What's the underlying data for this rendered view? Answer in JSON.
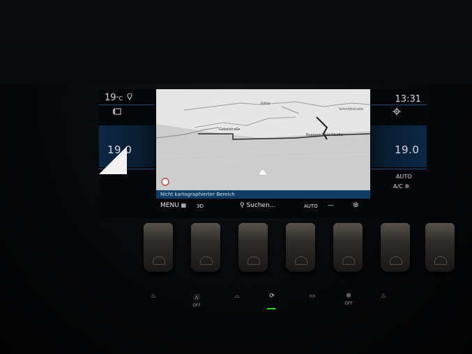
{
  "left_panel": {
    "outside_temp": "19",
    "temp_unit": "°C",
    "set_temperature": "19.0"
  },
  "right_panel": {
    "clock": "13:31",
    "set_temperature": "19.0",
    "auto_label": "AUTO",
    "ac_label": "A/C"
  },
  "map": {
    "street_labels": [
      "Ritter",
      "Gebelstraße",
      "Schmittstraße",
      "Ruppaer-Wald-Straße"
    ],
    "status_message": "Nicht kartographierter Bereich"
  },
  "bottom_bar": {
    "menu_label": "MENU",
    "view_label": "3D",
    "search_label": "Suchen...",
    "auto_label": "AUTO"
  },
  "lower_buttons": {
    "off_label_1": "OFF",
    "off_label_2": "OFF"
  },
  "colors": {
    "accent_blue": "#0f3d66",
    "indicator_green": "#2bdc2b"
  }
}
